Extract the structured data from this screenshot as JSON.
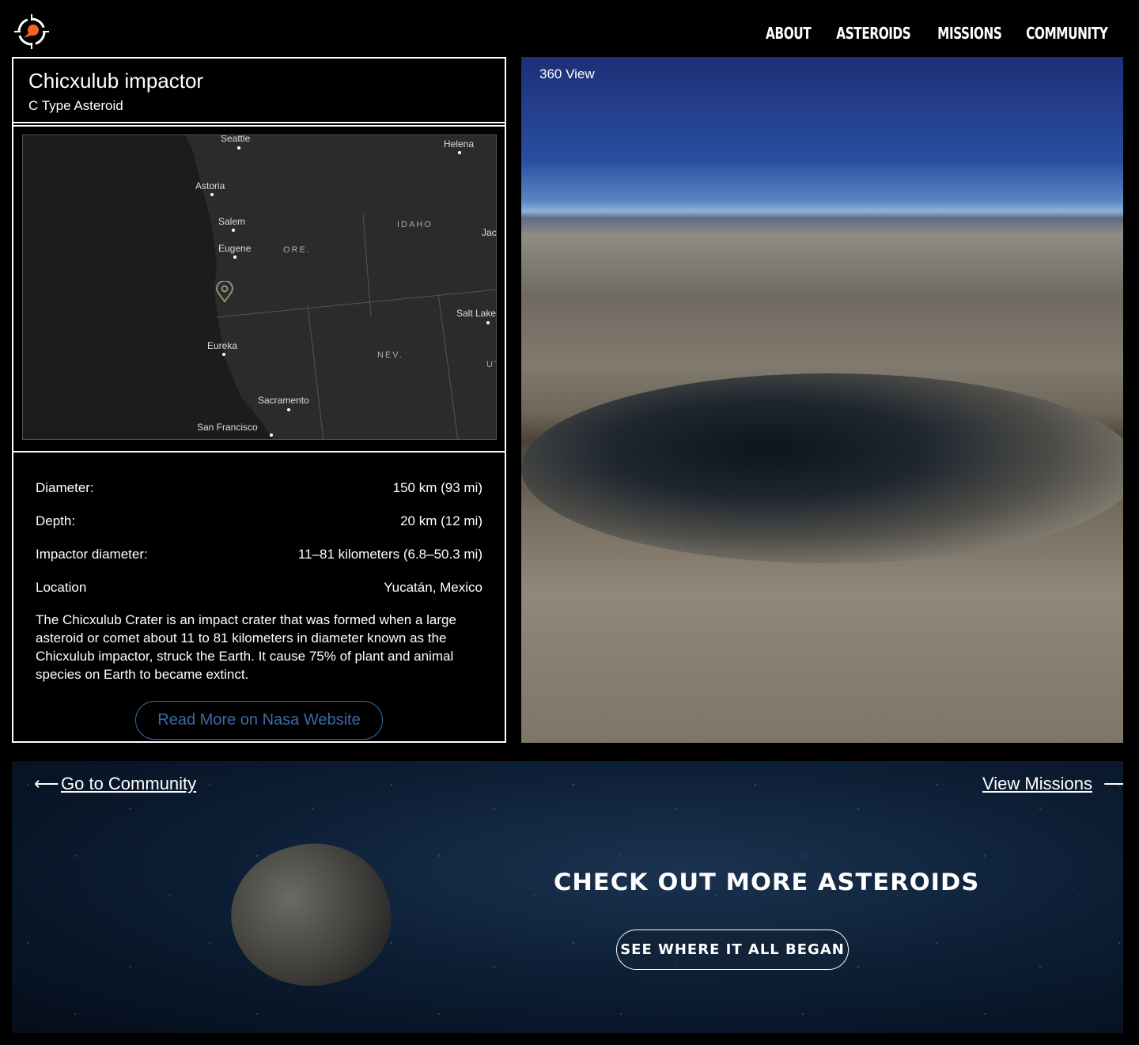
{
  "header": {
    "logo": "asteroid-logo",
    "nav": [
      "ABOUT",
      "ASTEROIDS",
      "MISSIONS",
      "COMMUNITY"
    ]
  },
  "asteroid": {
    "name": "Chicxulub impactor",
    "type": "C Type Asteroid"
  },
  "map": {
    "labels": [
      "Seattle",
      "Helena",
      "Astoria",
      "Salem",
      "IDAHO",
      "Jac",
      "Eugene",
      "ORE.",
      "Salt Lake",
      "Eureka",
      "NEV.",
      "UT",
      "Sacramento",
      "San Francisco"
    ],
    "marker": "location-pin-icon"
  },
  "facts": [
    {
      "label": "Diameter:",
      "value": "150 km (93 mi)"
    },
    {
      "label": "Depth:",
      "value": "20 km (12 mi)"
    },
    {
      "label": "Impactor diameter:",
      "value": "11–81 kilometers (6.8–50.3 mi)"
    },
    {
      "label": "Location",
      "value": "Yucatán, Mexico"
    }
  ],
  "description": "The Chicxulub Crater is an impact crater that was formed when a large asteroid or comet about 11 to 81 kilometers in diameter known as the Chicxulub impactor, struck the Earth. It cause 75% of plant and animal species on Earth to became extinct.",
  "read_more": "Read More on Nasa Website",
  "view_label": "360 View",
  "footer": {
    "prev": "Go to Community",
    "next": "View Missions",
    "heading": "CHECK OUT MORE ASTEROIDS",
    "cta": "SEE WHERE IT ALL BEGAN"
  },
  "colors": {
    "accent": "#3c6aa6",
    "logo": "#f26522"
  }
}
